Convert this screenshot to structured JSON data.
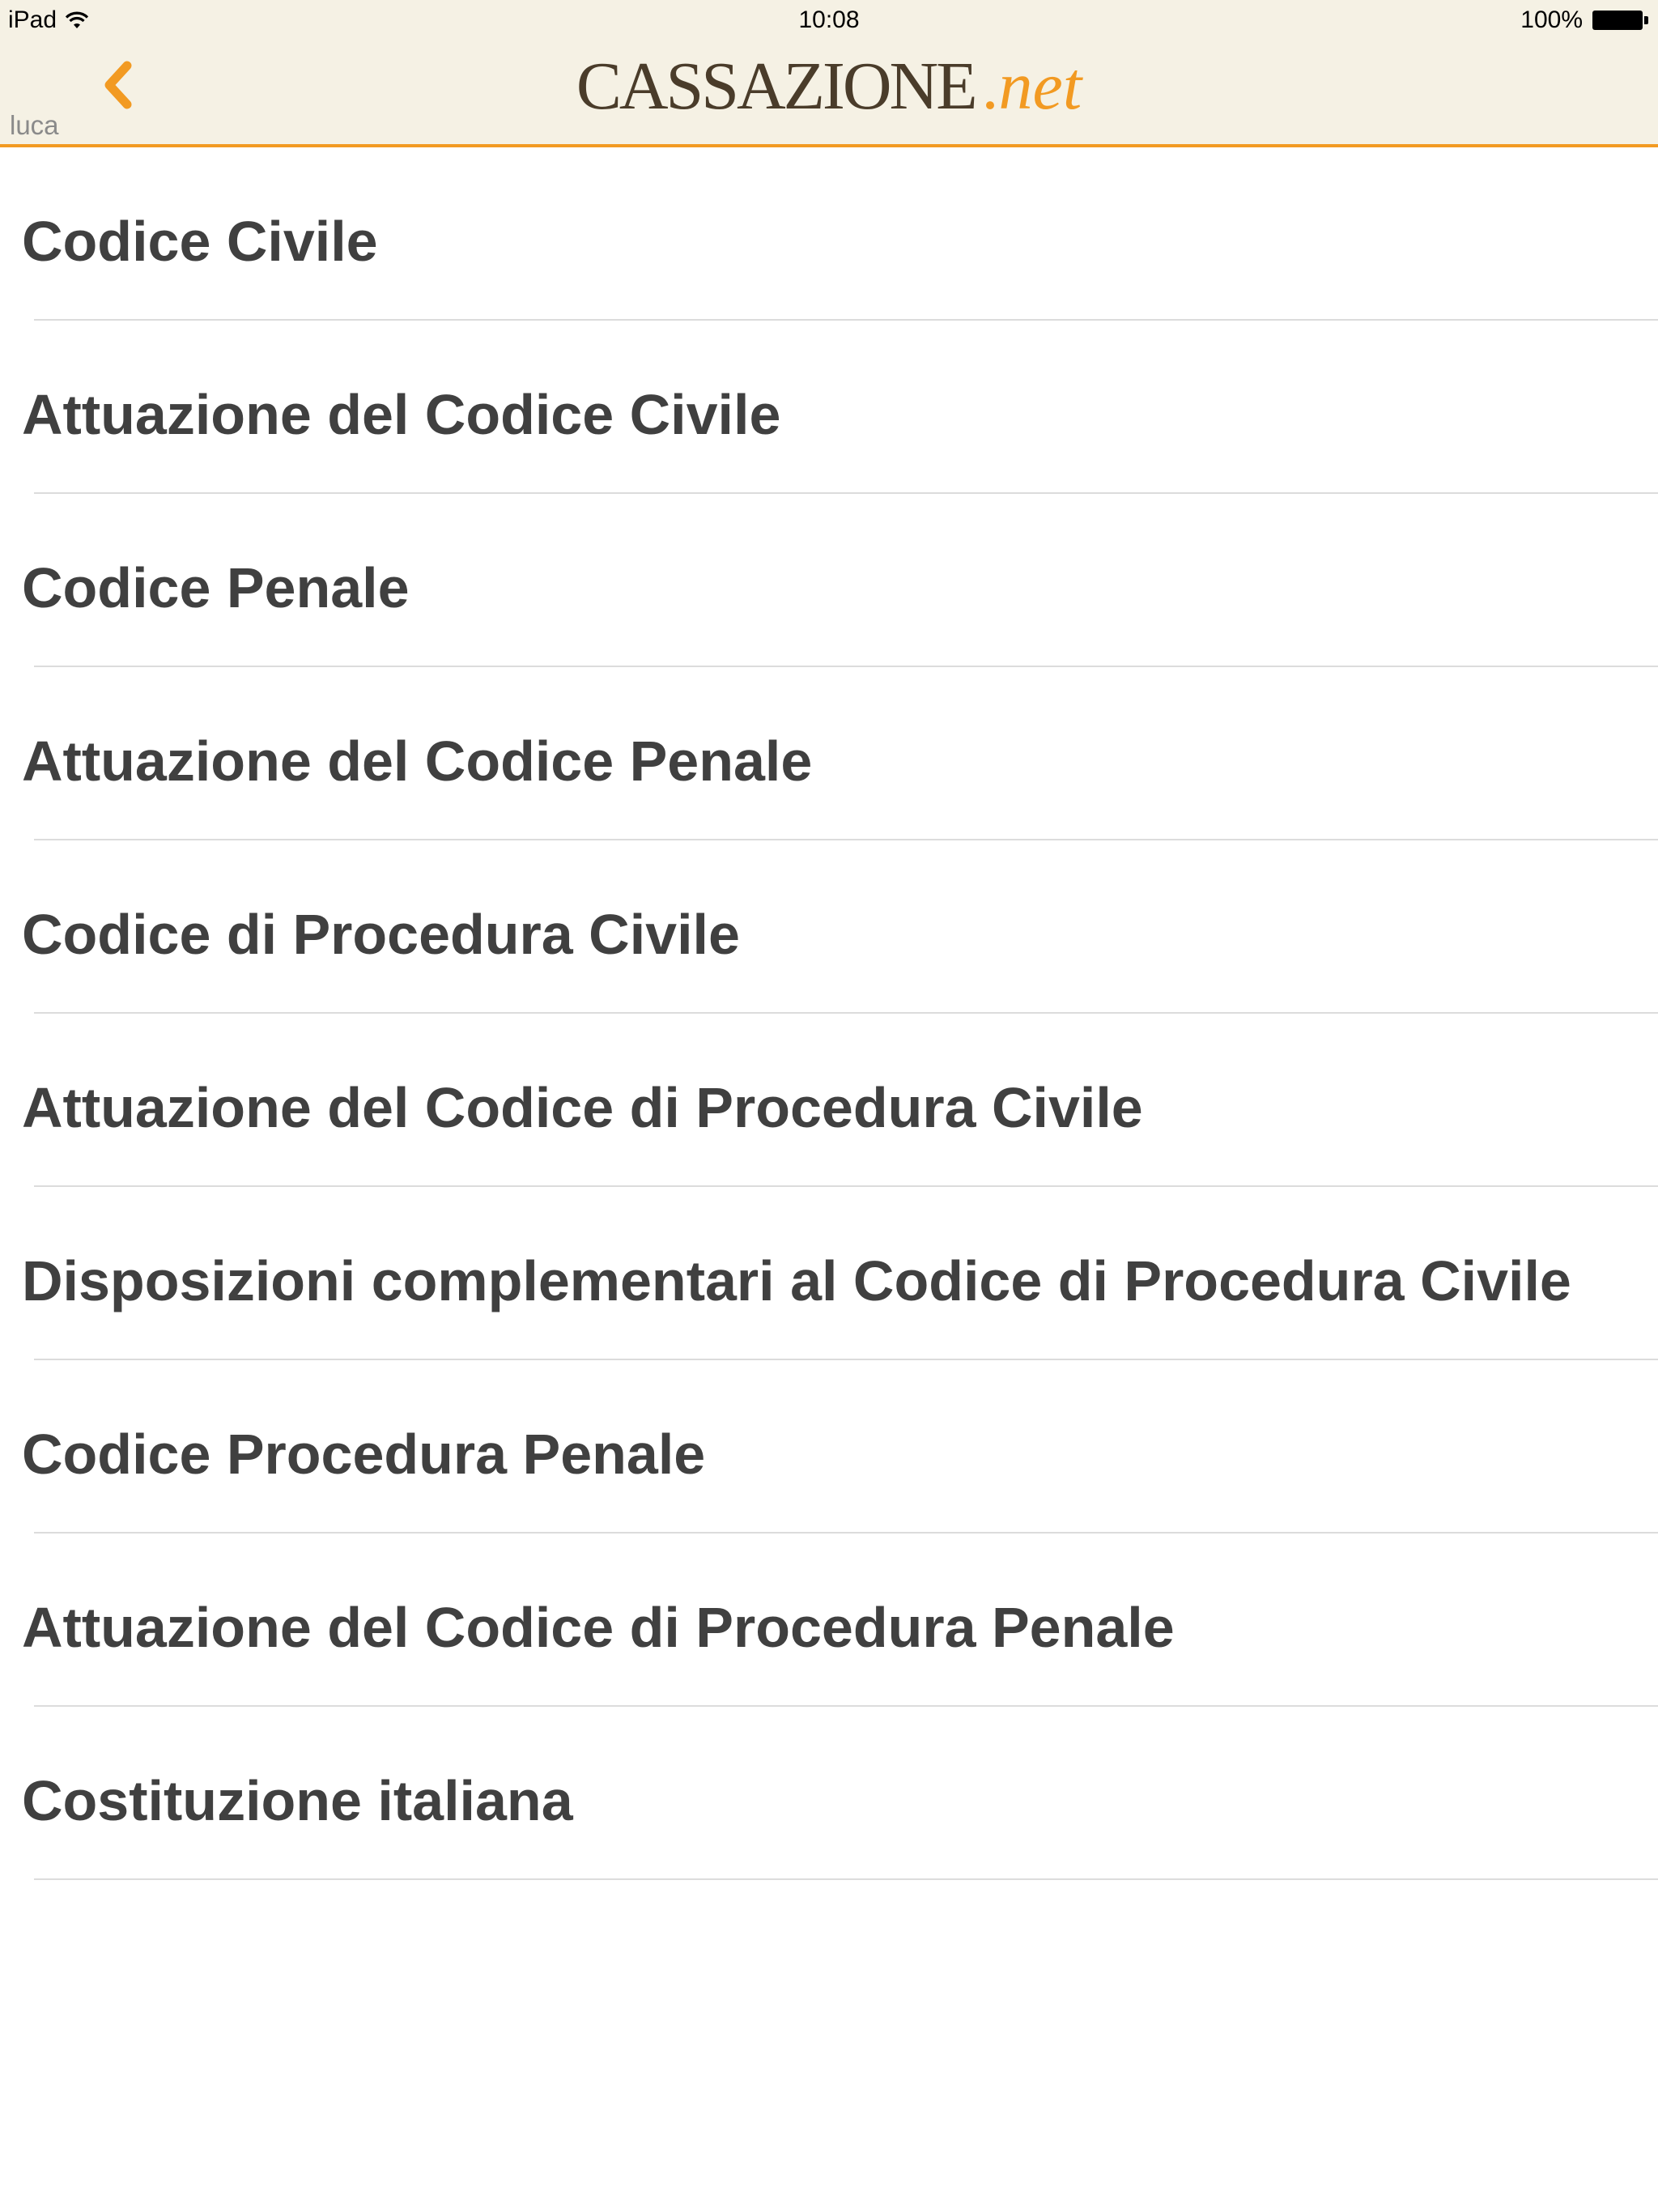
{
  "status_bar": {
    "device": "iPad",
    "time": "10:08",
    "battery": "100%"
  },
  "nav": {
    "back_label": "luca",
    "logo_main": "CASSAZIONE",
    "logo_dot": ".",
    "logo_net": "net"
  },
  "colors": {
    "accent": "#f29a22",
    "header_bg": "#f5f1e4",
    "text": "#404040",
    "separator": "#dcdcdc"
  },
  "items": [
    {
      "label": "Codice Civile"
    },
    {
      "label": "Attuazione del Codice Civile"
    },
    {
      "label": "Codice Penale"
    },
    {
      "label": "Attuazione del Codice Penale"
    },
    {
      "label": "Codice di Procedura Civile"
    },
    {
      "label": "Attuazione del Codice di Procedura Civile"
    },
    {
      "label": "Disposizioni complementari al Codice di Procedura Civile"
    },
    {
      "label": "Codice Procedura Penale"
    },
    {
      "label": "Attuazione del Codice di Procedura Penale"
    },
    {
      "label": "Costituzione italiana"
    }
  ]
}
